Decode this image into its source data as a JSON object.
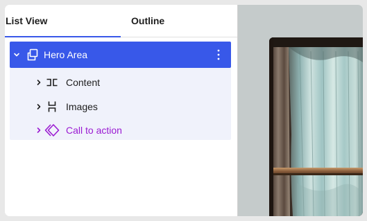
{
  "tabs": {
    "list_view": "List View",
    "outline": "Outline"
  },
  "tree": {
    "items": [
      {
        "label": "Hero Area",
        "icon": "group-icon",
        "expanded": true,
        "selected": true
      },
      {
        "label": "Content",
        "icon": "columns-icon",
        "expanded": false
      },
      {
        "label": "Images",
        "icon": "row-icon",
        "expanded": false
      },
      {
        "label": "Call to action",
        "icon": "diamond-arrows-icon",
        "expanded": false
      }
    ]
  },
  "colors": {
    "accent": "#3858e9",
    "tree_bg": "#f0f2fb",
    "cta_purple": "#9b1bd2",
    "canvas_bg": "#c5cbcb"
  }
}
